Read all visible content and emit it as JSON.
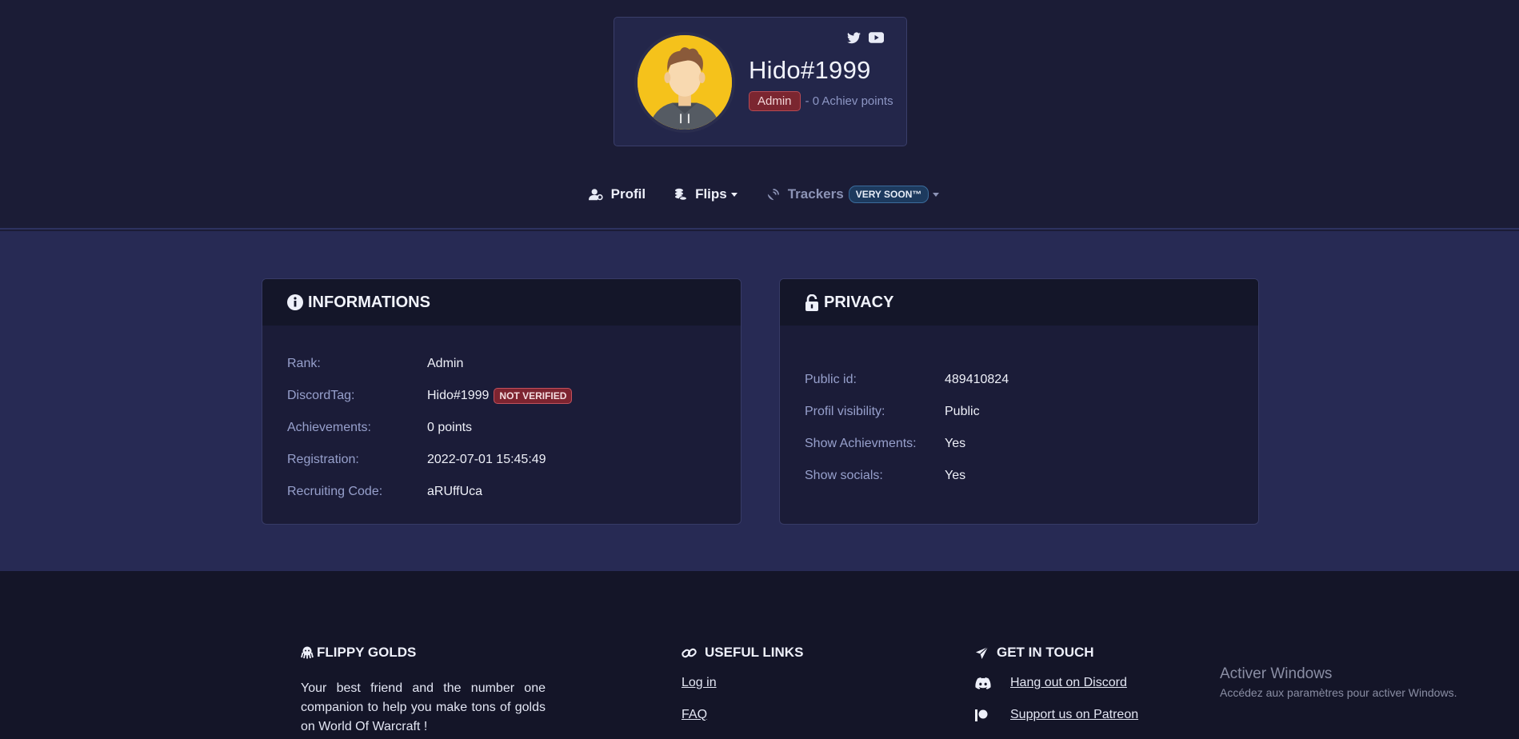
{
  "profile": {
    "username": "Hido#1999",
    "rank_badge": "Admin",
    "achiev_text": "- 0 Achiev points",
    "socials": [
      "twitter-icon",
      "youtube-icon"
    ]
  },
  "nav": {
    "items": [
      {
        "label": "Profil",
        "icon": "user-icon"
      },
      {
        "label": "Flips",
        "icon": "coins-icon"
      },
      {
        "label": "Trackers",
        "icon": "satellite-dish-icon",
        "badge": "VERY SOON™"
      }
    ]
  },
  "informations": {
    "title": "INFORMATIONS",
    "rows": [
      {
        "label": "Rank:",
        "value": "Admin"
      },
      {
        "label": "DiscordTag:",
        "value": "Hido#1999",
        "badge": "NOT VERIFIED"
      },
      {
        "label": "Achievements:",
        "value": "0 points"
      },
      {
        "label": "Registration:",
        "value": "2022-07-01 15:45:49"
      },
      {
        "label": "Recruiting Code:",
        "value": "aRUffUca"
      }
    ]
  },
  "privacy": {
    "title": "PRIVACY",
    "rows": [
      {
        "label": "Public id:",
        "value": "489410824"
      },
      {
        "label": "Profil visibility:",
        "value": "Public"
      },
      {
        "label": "Show Achievments:",
        "value": "Yes"
      },
      {
        "label": "Show socials:",
        "value": "Yes"
      }
    ]
  },
  "footer": {
    "brand": {
      "title": "FLIPPY GOLDS",
      "text": "Your best friend and the number one companion to help you make tons of golds on World Of Warcraft !"
    },
    "useful_links": {
      "title": "USEFUL LINKS",
      "links": [
        "Log in",
        "FAQ"
      ]
    },
    "contact": {
      "title": "GET IN TOUCH",
      "links": [
        "Hang out on Discord",
        "Support us on Patreon"
      ]
    }
  },
  "watermark": {
    "title": "Activer Windows",
    "subtitle": "Accédez aux paramètres pour activer Windows."
  },
  "colors": {
    "background": "#1b1c36",
    "main_area": "#272a54",
    "footer": "#141528",
    "badge_red": "#7b2630",
    "badge_blue": "#1d3a5e"
  }
}
